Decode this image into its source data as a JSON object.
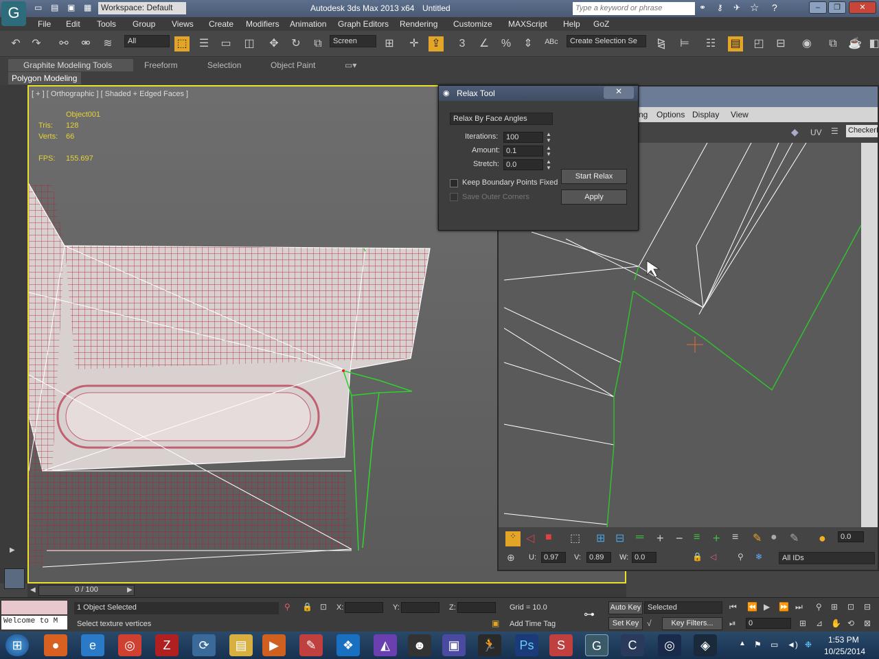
{
  "window": {
    "workspace": "Workspace: Default",
    "app_title": "Autodesk 3ds Max 2013 x64",
    "doc_title": "Untitled",
    "search_placeholder": "Type a keyword or phrase"
  },
  "menu": [
    "File",
    "Edit",
    "Tools",
    "Group",
    "Views",
    "Create",
    "Modifiers",
    "Animation",
    "Graph Editors",
    "Rendering",
    "Customize",
    "MAXScript",
    "Help",
    "GoZ"
  ],
  "toolbar": {
    "filter": "All",
    "ref_coord": "Screen",
    "selection_set": "Create Selection Se"
  },
  "ribbon": {
    "tabs": [
      "Graphite Modeling Tools",
      "Freeform",
      "Selection",
      "Object Paint"
    ],
    "panel": "Polygon Modeling"
  },
  "viewport": {
    "label": "[ + ] [ Orthographic ] [ Shaded + Edged Faces ]",
    "object": "Object001",
    "tris_label": "Tris:",
    "tris": "128",
    "verts_label": "Verts:",
    "verts": "66",
    "fps_label": "FPS:",
    "fps": "155.697"
  },
  "relax": {
    "title": "Relax Tool",
    "mode": "Relax By Face Angles",
    "iterations_label": "Iterations:",
    "iterations": "100",
    "amount_label": "Amount:",
    "amount": "0.1",
    "stretch_label": "Stretch:",
    "stretch": "0.0",
    "keep_boundary": "Keep Boundary Points Fixed",
    "save_corners": "Save Outer Corners",
    "start": "Start Relax",
    "apply": "Apply"
  },
  "uv": {
    "menu": [
      "ng",
      "Options",
      "Display",
      "View"
    ],
    "uv_label": "UV",
    "checker": "CheckerP",
    "u_label": "U:",
    "u": "0.97",
    "v_label": "V:",
    "v": "0.89",
    "w_label": "W:",
    "w": "0.0",
    "ids": "All IDs",
    "spin": "0.0"
  },
  "timeline": {
    "frame": "0 / 100"
  },
  "status": {
    "selected": "1 Object Selected",
    "prompt": "Select texture vertices",
    "welcome": "Welcome to M",
    "x_label": "X:",
    "y_label": "Y:",
    "z_label": "Z:",
    "grid": "Grid = 10.0",
    "add_time_tag": "Add Time Tag",
    "auto_key": "Auto Key",
    "set_key": "Set Key",
    "key_mode": "Selected",
    "key_filters": "Key Filters...",
    "frame": "0"
  },
  "clock": {
    "time": "1:53 PM",
    "date": "10/25/2014"
  }
}
